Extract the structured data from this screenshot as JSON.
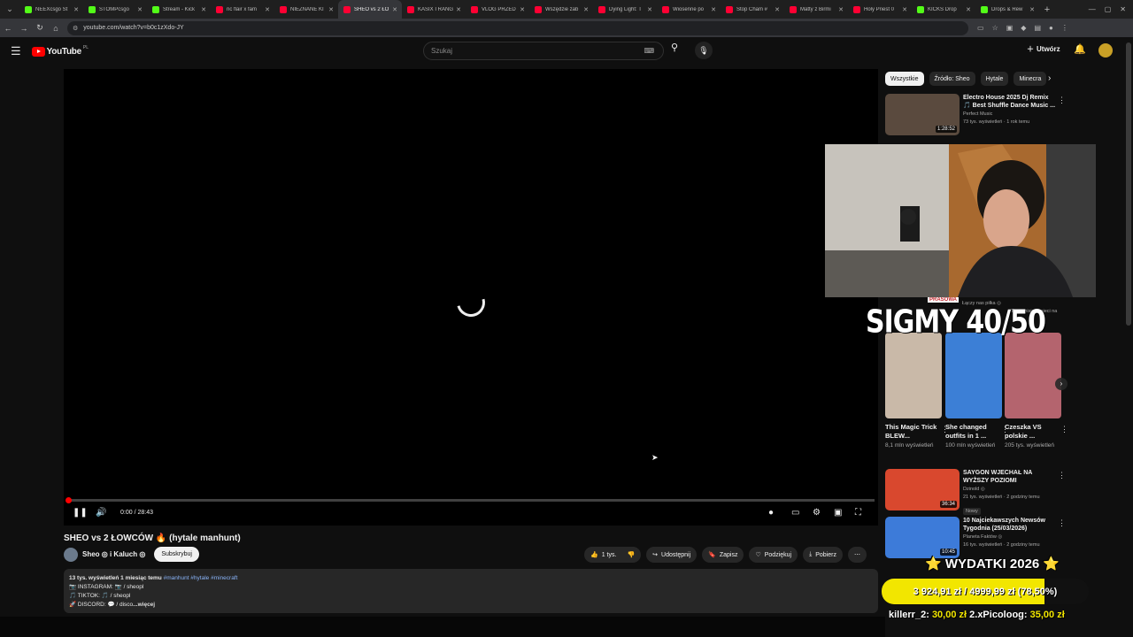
{
  "browser": {
    "tabs": [
      {
        "label": "NEEXcsgo St",
        "color": "#53fc18"
      },
      {
        "label": "STOMPcsgo",
        "color": "#53fc18"
      },
      {
        "label": "Stream - Kick",
        "color": "#53fc18"
      },
      {
        "label": "ric flair x fam",
        "color": "#ff0033"
      },
      {
        "label": "NIEZNANE KI",
        "color": "#ff0033"
      },
      {
        "label": "SHEO vs 2 ŁO",
        "color": "#ff0033",
        "active": true
      },
      {
        "label": "KASIX I RANG",
        "color": "#ff0033"
      },
      {
        "label": "VLOG PRZED",
        "color": "#ff0033"
      },
      {
        "label": "Wszędzie zab",
        "color": "#ff0033"
      },
      {
        "label": "Dying Light: T",
        "color": "#ff0033"
      },
      {
        "label": "Wiosenne po",
        "color": "#ff0033"
      },
      {
        "label": "Stop Cham #",
        "color": "#ff0033"
      },
      {
        "label": "Matty z Birmi",
        "color": "#ff0033"
      },
      {
        "label": "Holy Priest 0",
        "color": "#ff0033"
      },
      {
        "label": "KICKS Drop",
        "color": "#53fc18"
      },
      {
        "label": "Drops & Rew",
        "color": "#53fc18"
      }
    ],
    "url": "youtube.com/watch?v=b0c1zXdo-JY"
  },
  "header": {
    "logo_text": "YouTube",
    "country": "PL",
    "search_placeholder": "Szukaj",
    "create_label": "Utwórz"
  },
  "player": {
    "time": "0:00 / 28:43",
    "progress": 0.0
  },
  "video": {
    "title": "SHEO vs 2 ŁOWCÓW 🔥 (hytale manhunt)",
    "channel": "Sheo ◎ i Kaluch ◎",
    "subscribe": "Subskrybuj",
    "likes": "1 tys.",
    "share": "Udostępnij",
    "save": "Zapisz",
    "thanks": "Podziękuj",
    "download": "Pobierz"
  },
  "description": {
    "meta": "13 tys. wyświetleń  1 miesiąc temu",
    "tags": "#manhunt #hytale #minecraft",
    "line1": "📷 INSTAGRAM: 📷 / sheopl",
    "line2": "🎵 TIKTOK: 🎵 / sheopl",
    "line3": "🚀 DISCORD: 💬 / disco",
    "more": "...więcej"
  },
  "chips": [
    "Wszystkie",
    "Źródło: Sheo",
    "Hytale",
    "Minecra"
  ],
  "recommendations": [
    {
      "title": "Electro House 2025 Dj Remix 🎵 Best Shuffle Dance Music ...",
      "channel": "Perfect Music",
      "meta": "73 tys. wyświetleń · 1 rok temu",
      "duration": "1:28:52",
      "thumb_color": "#5a4a3e"
    },
    {
      "title": "SAYGON WJECHAŁ NA WYŻSZY POZIOMI",
      "channel": "Dzinold ◎",
      "meta": "21 tys. wyświetleń · 2 godziny temu",
      "badge": "Nowy",
      "duration": "36:34",
      "thumb_color": "#d9482e"
    },
    {
      "title": "10 Najciekawszych Newsów Tygodnia (25/03/2026)",
      "channel": "Planeta Faktów ◎",
      "meta": "16 tys. wyświetleń · 2 godziny temu",
      "duration": "10:45",
      "thumb_color": "#3d7bd9"
    }
  ],
  "shorts_header": {
    "line1": "Łączy nas piłka ◎",
    "line2": "Transmisje w sieci na"
  },
  "prasowa": "PRASOWA",
  "shorts": [
    {
      "title": "This Magic Trick BLEW...",
      "views": "8,1 mln wyświetleń",
      "color": "#c9b9a8"
    },
    {
      "title": "She changed outfits in 1 ...",
      "views": "100 mln wyświetleń",
      "color": "#3c7fd6"
    },
    {
      "title": "Czeszka VS polskie ...",
      "views": "205 tys. wyświetleń",
      "color": "#b4646e"
    }
  ],
  "overlay": {
    "sigmy": "SIGMY 40/50",
    "wydatki": "⭐ WYDATKI 2026 ⭐",
    "goal": "3 924,91 zł / 4999,99 zł (78,50%)",
    "goal_fraction": 0.785,
    "ticker_name1": "killerr_2:",
    "ticker_amt1": "30,00 zł",
    "ticker_name2": "2.xPicoloog:",
    "ticker_amt2": "35,00 zł"
  }
}
